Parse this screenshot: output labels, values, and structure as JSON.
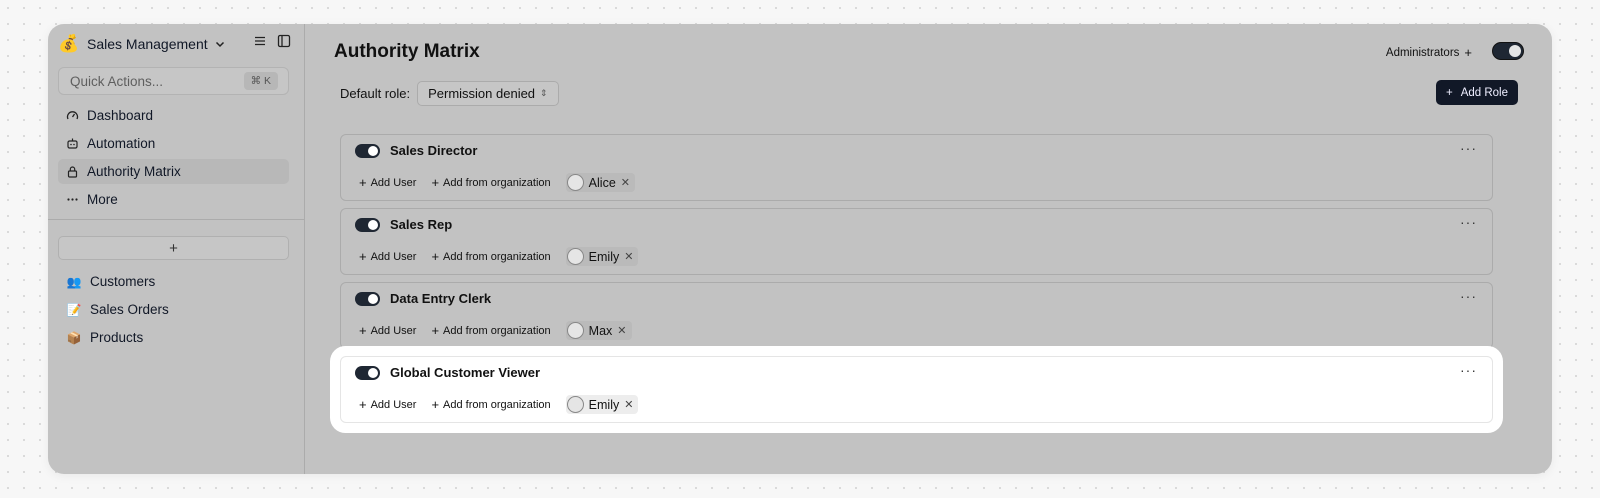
{
  "sidebar": {
    "workspace": {
      "emoji": "💰",
      "title": "Sales Management"
    },
    "quick_actions": {
      "placeholder": "Quick Actions...",
      "shortcut": "⌘ K"
    },
    "nav": [
      {
        "label": "Dashboard",
        "icon": "gauge-icon"
      },
      {
        "label": "Automation",
        "icon": "robot-icon"
      },
      {
        "label": "Authority Matrix",
        "icon": "lock-icon",
        "active": true
      },
      {
        "label": "More",
        "icon": "ellipsis-icon"
      }
    ],
    "add_label": "+",
    "collections": [
      {
        "emoji": "👥",
        "label": "Customers"
      },
      {
        "emoji": "📝",
        "label": "Sales Orders"
      },
      {
        "emoji": "📦",
        "label": "Products"
      }
    ]
  },
  "main": {
    "title": "Authority Matrix",
    "administrators_label": "Administrators",
    "default_role_label": "Default role:",
    "default_role_value": "Permission denied",
    "add_role_label": "Add Role",
    "roles": [
      {
        "name": "Sales Director",
        "add_user": "Add User",
        "add_org": "Add from organization",
        "user": "Alice"
      },
      {
        "name": "Sales Rep",
        "add_user": "Add User",
        "add_org": "Add from organization",
        "user": "Emily"
      },
      {
        "name": "Data Entry Clerk",
        "add_user": "Add User",
        "add_org": "Add from organization",
        "user": "Max"
      },
      {
        "name": "Global Customer Viewer",
        "add_user": "Add User",
        "add_org": "Add from organization",
        "user": "Emily",
        "highlighted": true
      }
    ]
  },
  "colors": {
    "overlay": "#c2c2c2",
    "accent_dark": "#111827",
    "highlight": "#ffffff"
  }
}
